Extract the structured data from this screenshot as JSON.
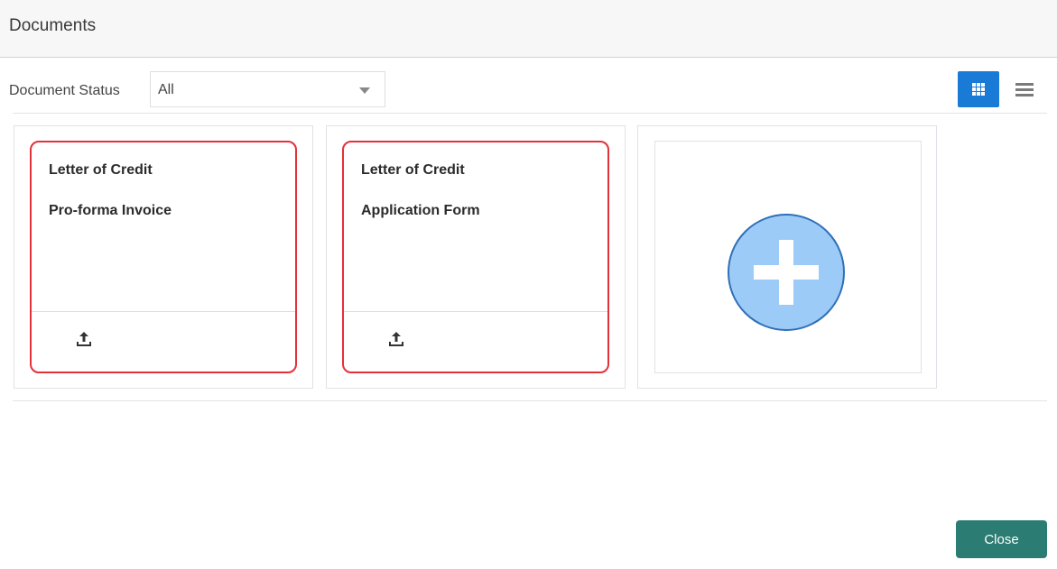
{
  "header": {
    "title": "Documents"
  },
  "filter": {
    "label": "Document Status",
    "selected": "All"
  },
  "view_toggle": {
    "grid_icon": "grid-view-icon",
    "list_icon": "list-view-icon",
    "active": "grid"
  },
  "documents": [
    {
      "title": "Letter of Credit",
      "subtitle": "Pro-forma Invoice",
      "icon": "upload-icon"
    },
    {
      "title": "Letter of Credit",
      "subtitle": "Application Form",
      "icon": "upload-icon"
    }
  ],
  "add_card": {
    "icon": "plus-circle-icon"
  },
  "footer": {
    "close_label": "Close"
  },
  "colors": {
    "accent_blue": "#1a7bd6",
    "mandatory_border": "#e3313a",
    "close_button": "#2b7c72",
    "add_circle": "#9ccbf7"
  }
}
